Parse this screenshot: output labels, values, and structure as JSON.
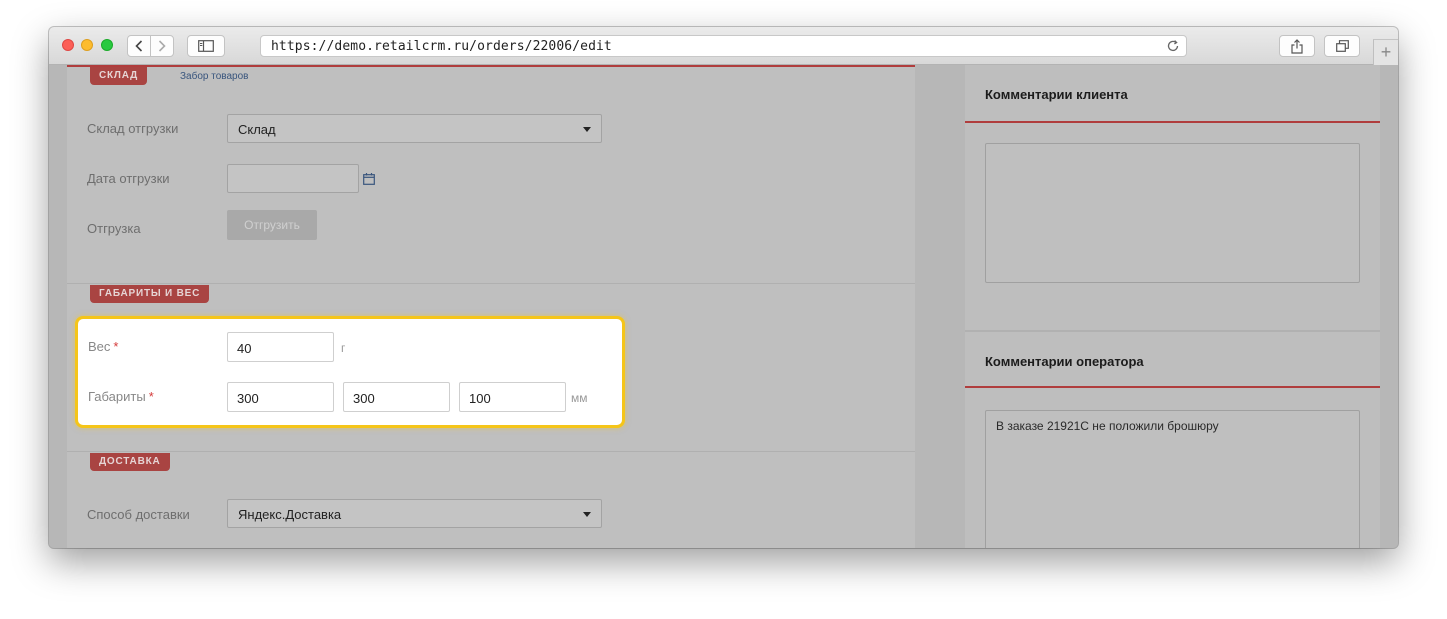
{
  "browser": {
    "url": "https://demo.retailcrm.ru/orders/22006/edit",
    "back_icon": "chevron-left-icon",
    "forward_icon": "chevron-right-icon",
    "new_tab_label": "+"
  },
  "warehouse": {
    "tag": "СКЛАД",
    "pick_link": "Забор товаров",
    "shipping_warehouse_label": "Склад отгрузки",
    "shipping_warehouse_value": "Склад",
    "shipping_date_label": "Дата отгрузки",
    "shipping_date_value": "",
    "shipment_label": "Отгрузка",
    "ship_button": "Отгрузить"
  },
  "dimensions": {
    "tag": "ГАБАРИТЫ И ВЕС",
    "weight_label": "Вес",
    "weight_value": "40",
    "weight_unit": "г",
    "dimensions_label": "Габариты",
    "length": "300",
    "width": "300",
    "height": "100",
    "dim_unit": "мм",
    "required_mark": "*"
  },
  "delivery": {
    "tag": "ДОСТАВКА",
    "method_label": "Способ доставки",
    "method_value": "Яндекс.Доставка"
  },
  "comments": {
    "client_title": "Комментарии клиента",
    "client_text": "",
    "operator_title": "Комментарии оператора",
    "operator_text": "В заказе 21921C не положили брошюру"
  },
  "colors": {
    "accent_red": "#a94442",
    "highlight_border": "#f5c518",
    "required_star": "#d43a3a"
  }
}
